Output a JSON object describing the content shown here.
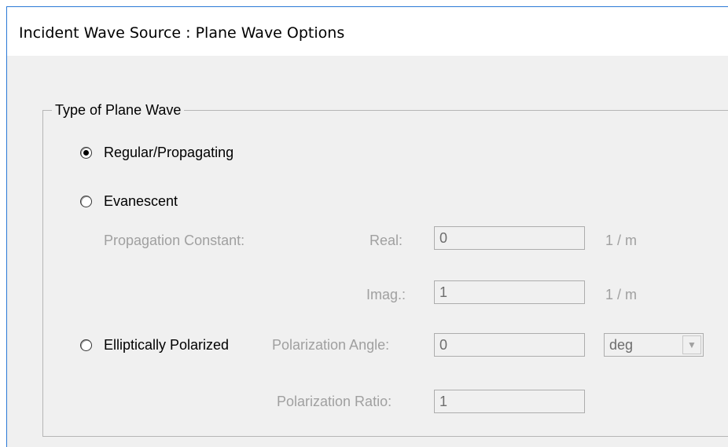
{
  "window": {
    "title": "Incident Wave Source : Plane Wave Options"
  },
  "group": {
    "legend": "Type of Plane Wave"
  },
  "options": {
    "regular": {
      "label": "Regular/Propagating",
      "selected": true
    },
    "evanescent": {
      "label": "Evanescent",
      "selected": false
    },
    "elliptical": {
      "label": "Elliptically Polarized",
      "selected": false
    }
  },
  "propagation": {
    "label": "Propagation Constant:",
    "real_label": "Real:",
    "real_value": "0",
    "real_unit": "1 / m",
    "imag_label": "Imag.:",
    "imag_value": "1",
    "imag_unit": "1 / m"
  },
  "polarization": {
    "angle_label": "Polarization Angle:",
    "angle_value": "0",
    "angle_unit": "deg",
    "ratio_label": "Polarization Ratio:",
    "ratio_value": "1"
  },
  "colors": {
    "window_border": "#2b79d6",
    "disabled_text": "#a0a0a0",
    "background": "#f0f0f0"
  }
}
